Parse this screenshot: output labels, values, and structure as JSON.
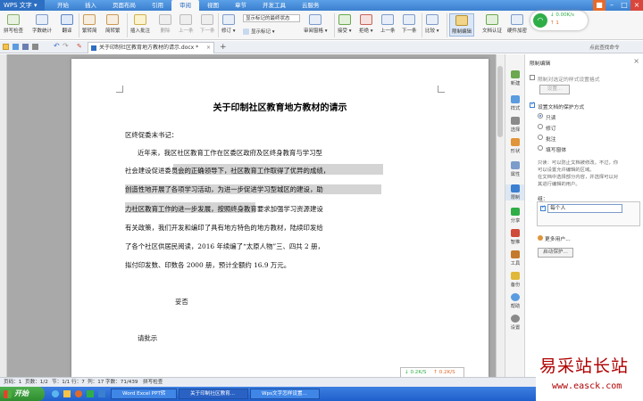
{
  "app": {
    "name": "WPS 文字"
  },
  "menu_tabs": [
    "开始",
    "插入",
    "页面布局",
    "引用",
    "审阅",
    "视图",
    "章节",
    "开发工具",
    "云服务"
  ],
  "active_tab": "审阅",
  "ribbon": {
    "spell_check": "拼写检查",
    "word_count": "字数统计",
    "translate": "翻译",
    "simp_trad": "繁转简",
    "trad_simp": "简转繁",
    "insert_comment": "插入批注",
    "delete": "删除",
    "prev": "上一条",
    "next": "下一条",
    "revise": "修订",
    "show_markup_dropdown": "显示标记的最终状态",
    "show_markup": "显示标记",
    "review_pane": "审阅窗格",
    "accept": "接受",
    "reject": "拒绝",
    "prev2": "上一条",
    "next2": "下一条",
    "compare": "比较",
    "restrict_edit": "限制编辑",
    "doc_auth": "文档认证",
    "hw_auth": "硬件加密"
  },
  "network": {
    "down": "0.00K/s",
    "up": "0.00K/s",
    "count": "1"
  },
  "doc_tab": {
    "title": "关于印制社区教育地方教材的请示.docx *",
    "add": "+"
  },
  "top_right_login": "点此查找命令",
  "document": {
    "title": "关于印制社区教育地方教材的请示",
    "addressee": "区终促委末书记：",
    "lines": [
      "近年来，我区社区教育工作在区委区政府及区终身教育与学习型",
      "社会建设促进委员会的正确领导下，社区教育工作取得了优异的成绩，",
      "创造性地开展了各项学习活动，为进一步促进学习型城区的建设，助",
      "力社区教育工作的进一步发展，按照终身教育要求加强学习资源建设",
      "有关政策，我们开发和编印了具有地方特色的地方教材，陆续印发给",
      "了各个社区供居民阅读，2016 年续编了“太原人物”三、四共 2 册，",
      "拟付印发数、印数各 2000 册，预计全额约 16.9 万元。"
    ],
    "closing": "妥否",
    "request": "请批示"
  },
  "side_tools": [
    "新建",
    "样式",
    "选择",
    "形状",
    "属性",
    "限制",
    "分享",
    "智推",
    "工具",
    "备份",
    "帮助",
    "设置"
  ],
  "panel": {
    "title": "限制编辑",
    "opt1": "限制对选定的样式设置格式",
    "settings_btn": "设置...",
    "opt2": "设置文档的保护方式",
    "radio_readonly": "只读",
    "radio_revision": "修订",
    "radio_comment": "批注",
    "radio_form": "填写窗体",
    "desc": [
      "只读：可以防止文档被修改。不过，你",
      "可以设置允许编辑的区域。",
      "在文档中选择部分内容，并选择可以对",
      "其进行编辑的用户。"
    ],
    "group_label": "组：",
    "everyone": "每个人",
    "more_users": "更多用户...",
    "start_protect": "启动保护..."
  },
  "net_popup": {
    "down": "0.2K/S",
    "up": "0.2K/S"
  },
  "status": {
    "page_no": "页码：1",
    "pages": "页数：1/2",
    "section": "节：1/1",
    "row": "行：7",
    "col": "列：17",
    "words": "字数：71/439",
    "spell": "拼写检查"
  },
  "taskbar": {
    "start": "开始",
    "tasks": [
      "Word Excel PPT转",
      "关于印制社区教育...",
      "Wps文字怎样设置..."
    ]
  },
  "watermark": {
    "text": "易采站长站",
    "url": "www.easck.com"
  },
  "colors": {
    "accent": "#3b7fd0",
    "panel_bg": "#ffffff",
    "highlight": "#d4d4d4",
    "watermark": "#b00000"
  }
}
